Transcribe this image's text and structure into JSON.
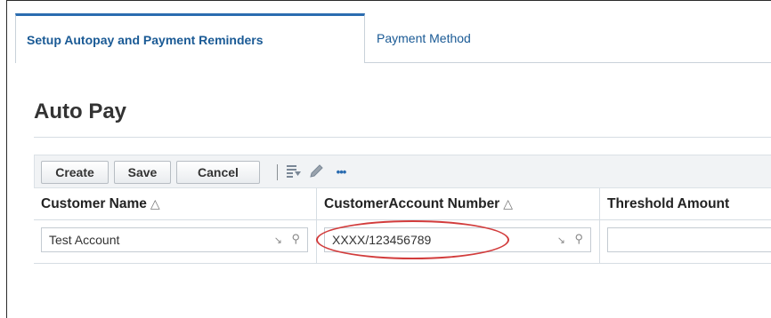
{
  "tabs": [
    {
      "label": "Setup Autopay and Payment Reminders",
      "active": true
    },
    {
      "label": "Payment Method",
      "active": false
    }
  ],
  "page_title": "Auto Pay",
  "toolbar": {
    "create_label": "Create",
    "save_label": "Save",
    "cancel_label": "Cancel",
    "more_label": "•••",
    "icons": [
      "export-icon",
      "edit-icon",
      "more-icon"
    ]
  },
  "table": {
    "columns": [
      {
        "label": "Customer Name",
        "sort_icon": "△"
      },
      {
        "label": "CustomerAccount Number",
        "sort_icon": "△"
      },
      {
        "label": "Threshold Amount"
      }
    ],
    "filter_values": [
      "Test Account",
      "XXXX/123456789",
      ""
    ]
  },
  "colors": {
    "accent": "#1a5a95",
    "highlight": "#d23c3c"
  }
}
